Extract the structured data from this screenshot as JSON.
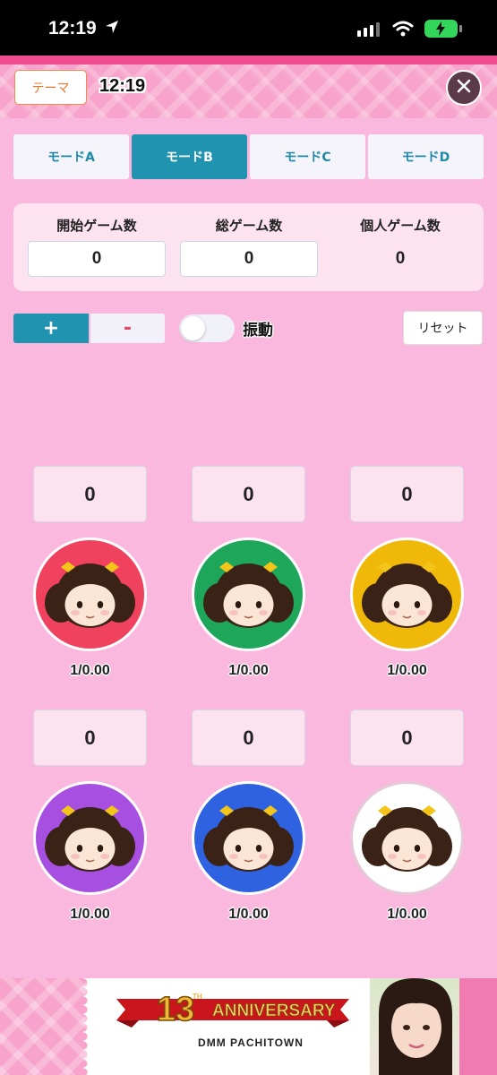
{
  "status_bar": {
    "time": "12:19"
  },
  "header": {
    "theme_label": "テーマ",
    "clock": "12:19"
  },
  "tabs": [
    {
      "label": "モードA",
      "active": false
    },
    {
      "label": "モードB",
      "active": true
    },
    {
      "label": "モードC",
      "active": false
    },
    {
      "label": "モードD",
      "active": false
    }
  ],
  "counters": [
    {
      "label": "開始ゲーム数",
      "value": "0"
    },
    {
      "label": "総ゲーム数",
      "value": "0"
    },
    {
      "label": "個人ゲーム数",
      "value": "0"
    }
  ],
  "controls": {
    "plus": "+",
    "minus": "-",
    "vibration_label": "振動",
    "vibration_on": false,
    "reset": "リセット"
  },
  "players": [
    {
      "count": "0",
      "ratio": "1/0.00",
      "color": "#f0415e"
    },
    {
      "count": "0",
      "ratio": "1/0.00",
      "color": "#1ea65a"
    },
    {
      "count": "0",
      "ratio": "1/0.00",
      "color": "#f0b90a"
    },
    {
      "count": "0",
      "ratio": "1/0.00",
      "color": "#a64fe0"
    },
    {
      "count": "0",
      "ratio": "1/0.00",
      "color": "#2f62e0"
    },
    {
      "count": "0",
      "ratio": "1/0.00",
      "color": "#ffffff"
    }
  ],
  "banner": {
    "title": "13TH ANNIVERSARY",
    "subtitle": "DMM PACHITOWN"
  },
  "colors": {
    "accent": "#1f93af",
    "header_pink": "#f7a3cb",
    "background": "#fbb8df"
  }
}
